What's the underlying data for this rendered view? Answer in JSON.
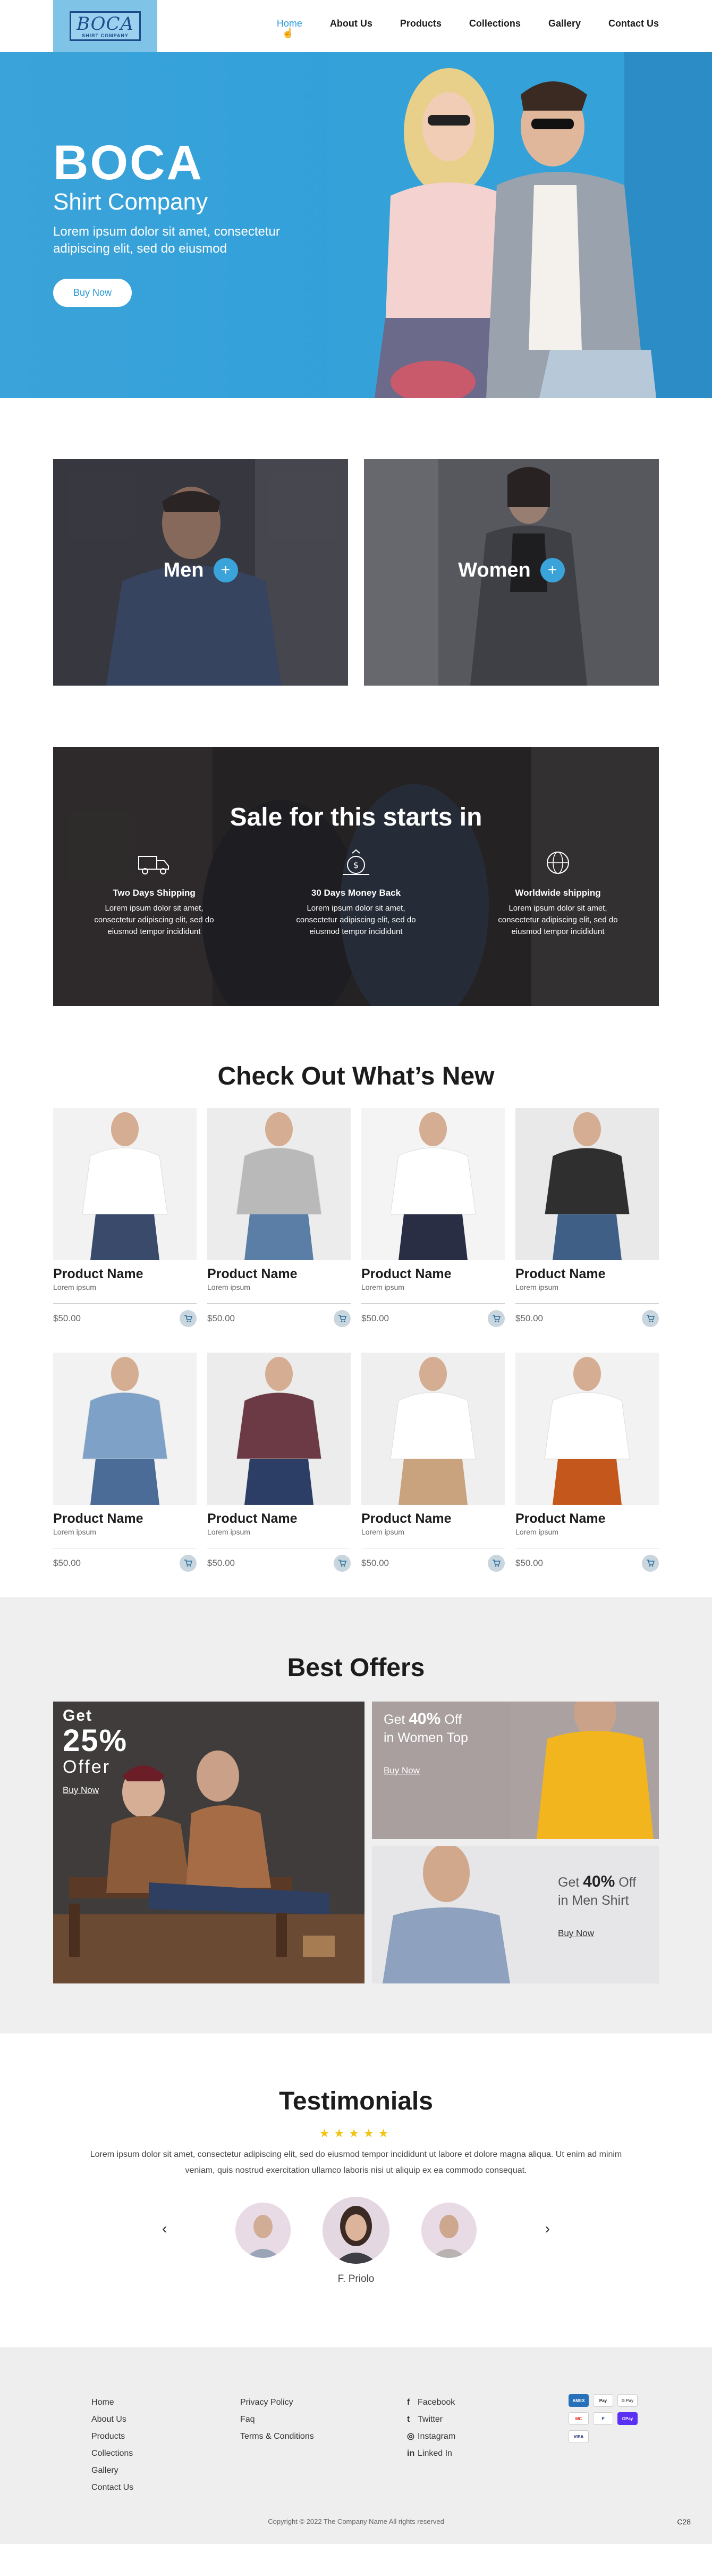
{
  "header": {
    "logo_main": "BOCA",
    "logo_sub": "SHIRT COMPANY",
    "nav": [
      "Home",
      "About Us",
      "Products",
      "Collections",
      "Gallery",
      "Contact Us"
    ]
  },
  "hero": {
    "title": "BOCA",
    "subtitle": "Shirt Company",
    "desc": "Lorem ipsum dolor sit amet, consectetur adipiscing elit, sed do eiusmod",
    "button": "Buy Now"
  },
  "categories": [
    "Men",
    "Women"
  ],
  "sale": {
    "title": "Sale for this starts in",
    "features": [
      {
        "title": "Two Days Shipping",
        "desc": "Lorem ipsum dolor sit amet, consectetur adipiscing elit, sed do eiusmod tempor incididunt",
        "icon": "truck-icon"
      },
      {
        "title": "30 Days Money Back",
        "desc": "Lorem ipsum dolor sit amet, consectetur adipiscing elit, sed do eiusmod tempor incididunt",
        "icon": "money-back-icon"
      },
      {
        "title": "Worldwide shipping",
        "desc": "Lorem ipsum dolor sit amet, consectetur adipiscing elit, sed do eiusmod tempor incididunt",
        "icon": "globe-icon"
      }
    ]
  },
  "whats_new": {
    "title": "Check Out What’s New",
    "products": [
      {
        "name": "Product Name",
        "desc": "Lorem ipsum",
        "price": "$50.00"
      },
      {
        "name": "Product Name",
        "desc": "Lorem ipsum",
        "price": "$50.00"
      },
      {
        "name": "Product Name",
        "desc": "Lorem ipsum",
        "price": "$50.00"
      },
      {
        "name": "Product Name",
        "desc": "Lorem ipsum",
        "price": "$50.00"
      },
      {
        "name": "Product Name",
        "desc": "Lorem ipsum",
        "price": "$50.00"
      },
      {
        "name": "Product Name",
        "desc": "Lorem ipsum",
        "price": "$50.00"
      },
      {
        "name": "Product Name",
        "desc": "Lorem ipsum",
        "price": "$50.00"
      },
      {
        "name": "Product Name",
        "desc": "Lorem ipsum",
        "price": "$50.00"
      }
    ]
  },
  "offers": {
    "title": "Best Offers",
    "big": {
      "get": "Get",
      "pct": "25%",
      "offer": "Offer",
      "link": "Buy Now"
    },
    "women": {
      "pre": "Get",
      "pct": "40%",
      "post": "Off",
      "line2": "in Women Top",
      "link": "Buy Now"
    },
    "men": {
      "pre": "Get",
      "pct": "40%",
      "post": "Off",
      "line2": "in Men Shirt",
      "link": "Buy Now"
    }
  },
  "testimonials": {
    "title": "Testimonials",
    "stars": "★★★★★",
    "text": "Lorem ipsum dolor sit amet, consectetur adipiscing elit, sed do eiusmod tempor incididunt ut labore et dolore magna aliqua. Ut enim ad minim veniam, quis nostrud exercitation ullamco laboris nisi ut aliquip ex ea commodo consequat.",
    "name": "F. Priolo",
    "prev": "‹",
    "next": "›"
  },
  "footer": {
    "col1": [
      "Home",
      "About Us",
      "Products",
      "Collections",
      "Gallery",
      "Contact Us"
    ],
    "col2": [
      "Privacy Policy",
      "Faq",
      "Terms & Conditions"
    ],
    "social": [
      {
        "label": "Facebook",
        "icon": "f"
      },
      {
        "label": "Twitter",
        "icon": "t"
      },
      {
        "label": "Instagram",
        "icon": "◎"
      },
      {
        "label": "Linked In",
        "icon": "in"
      }
    ],
    "payments": [
      "AMEX",
      "Pay",
      "G Pay",
      "MC",
      "P",
      "GPay",
      "VISA"
    ],
    "copyright": "Copyright © 2022 The Company Name All rights reserved",
    "corner": "C28"
  }
}
